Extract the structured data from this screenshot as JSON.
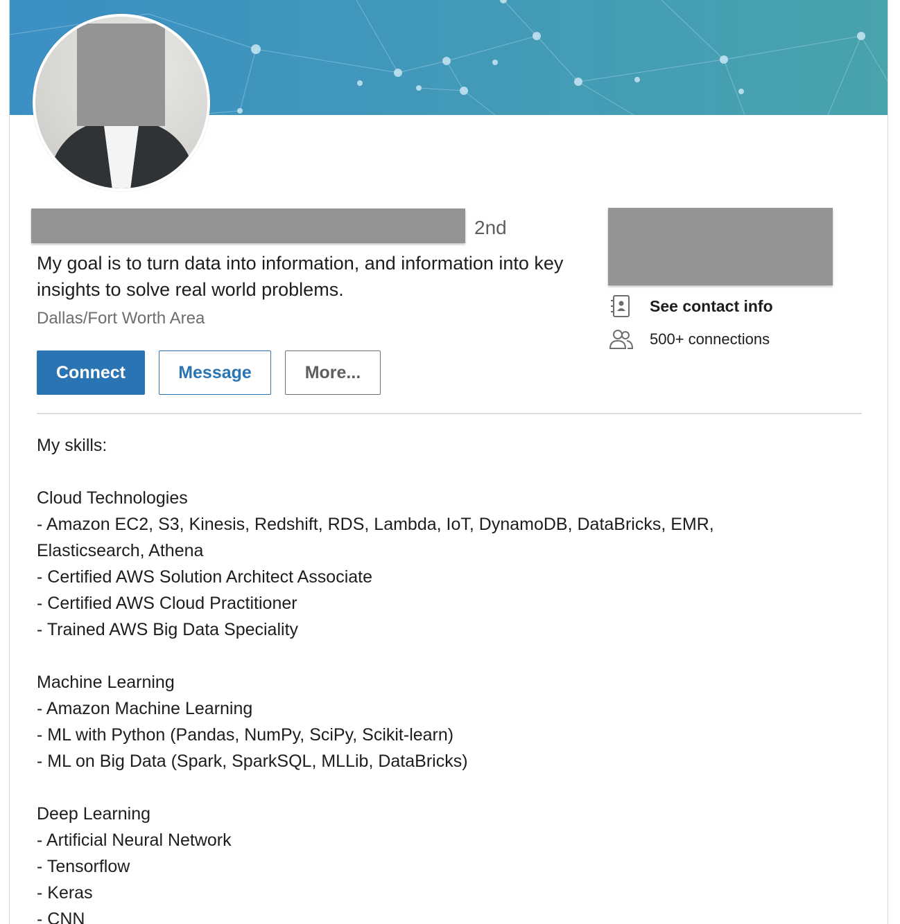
{
  "profile": {
    "degree": "2nd",
    "headline": "My goal is to turn data into information, and information into key insights to solve real world problems.",
    "location": "Dallas/Fort Worth Area"
  },
  "actions": {
    "connect": "Connect",
    "message": "Message",
    "more": "More..."
  },
  "sidebar": {
    "contact_info": "See contact info",
    "connections": "500+ connections"
  },
  "summary": {
    "lines": [
      "My skills:",
      "",
      "Cloud Technologies",
      "- Amazon EC2, S3, Kinesis, Redshift, RDS, Lambda, IoT, DynamoDB, DataBricks, EMR,",
      "Elasticsearch, Athena",
      "- Certified AWS Solution Architect Associate",
      "- Certified AWS Cloud Practitioner",
      "- Trained AWS Big Data Speciality",
      "",
      "Machine Learning",
      "- Amazon Machine Learning",
      "- ML with Python (Pandas, NumPy, SciPy, Scikit-learn)",
      "- ML on Big Data (Spark, SparkSQL, MLLib, DataBricks)",
      "",
      "Deep Learning",
      "- Artificial Neural Network",
      "- Tensorflow",
      "- Keras",
      "- CNN"
    ]
  },
  "colors": {
    "brand_blue": "#2a74b4",
    "cover_start": "#3b8fc4",
    "cover_end": "#49a3ad",
    "redaction": "#949494"
  },
  "icons": {
    "contact": "address-book-icon",
    "connections": "people-icon"
  }
}
